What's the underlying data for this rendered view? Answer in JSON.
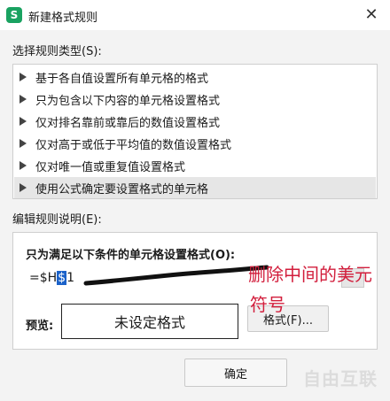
{
  "window": {
    "title": "新建格式规则",
    "app_icon_glyph": "S",
    "close_glyph": "✕"
  },
  "rule_type": {
    "label": "选择规则类型(S):",
    "items": [
      {
        "label": "基于各自值设置所有单元格的格式"
      },
      {
        "label": "只为包含以下内容的单元格设置格式"
      },
      {
        "label": "仅对排名靠前或靠后的数值设置格式"
      },
      {
        "label": "仅对高于或低于平均值的数值设置格式"
      },
      {
        "label": "仅对唯一值或重复值设置格式"
      },
      {
        "label": "使用公式确定要设置格式的单元格",
        "selected": true
      }
    ]
  },
  "description": {
    "label": "编辑规则说明(E):",
    "condition_title": "只为满足以下条件的单元格设置格式(O):",
    "formula": {
      "before": "=$H",
      "selected": "$",
      "after": "1"
    },
    "preview_label": "预览:",
    "preview_text": "未设定格式",
    "format_button": "格式(F)..."
  },
  "annotation": {
    "line1": "删除中间的美元",
    "line2": "符号",
    "color": "#d21e3c"
  },
  "buttons": {
    "ok": "确定"
  },
  "watermark": "自由互联",
  "colors": {
    "app_icon": "#1aa261",
    "selection": "#1b62c9"
  }
}
